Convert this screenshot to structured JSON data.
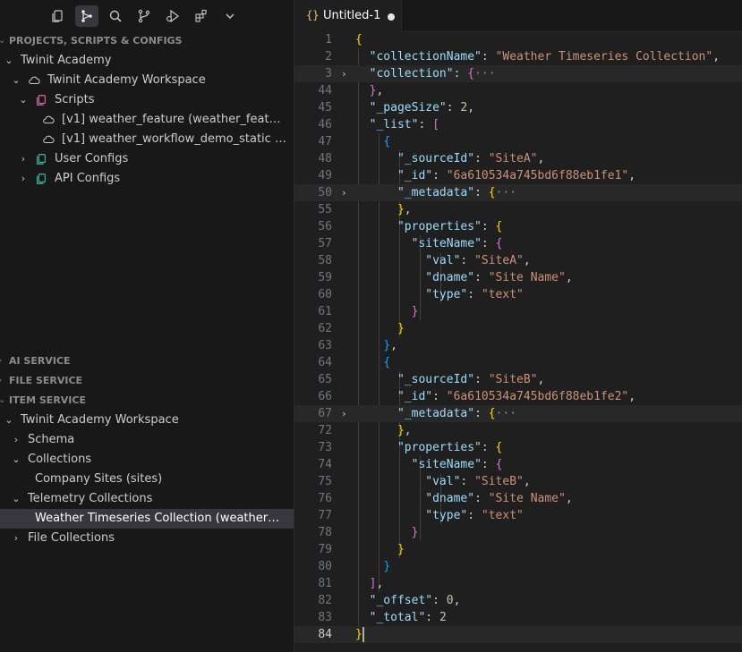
{
  "toolbar": {
    "icons": [
      "files-icon",
      "workflow-icon",
      "search-icon",
      "source-control-icon",
      "run-debug-icon",
      "extensions-icon",
      "chevron-down-icon"
    ]
  },
  "sidebar": {
    "section_projects": "PROJECTS, SCRIPTS & CONFIGS",
    "projects_tree": [
      "Twinit Academy",
      "Twinit Academy Workspace",
      "Scripts",
      "[v1] weather_feature (weather_feature) <...",
      "[v1] weather_workflow_demo_static (weat...",
      "User Configs",
      "API Configs"
    ],
    "section_ai": "AI SERVICE",
    "section_file": "FILE SERVICE",
    "section_item": "ITEM SERVICE",
    "item_tree": [
      "Twinit Academy Workspace",
      "Schema",
      "Collections",
      "Company Sites (sites)",
      "Telemetry Collections",
      "Weather Timeseries Collection (weather_times...",
      "File Collections"
    ]
  },
  "editor": {
    "tab_icon": "{}",
    "tab_title": "Untitled-1",
    "line_numbers": [
      "1",
      "2",
      "3",
      "44",
      "45",
      "46",
      "47",
      "48",
      "49",
      "50",
      "55",
      "56",
      "57",
      "58",
      "59",
      "60",
      "61",
      "62",
      "63",
      "64",
      "65",
      "66",
      "67",
      "72",
      "73",
      "74",
      "75",
      "76",
      "77",
      "78",
      "79",
      "80",
      "81",
      "82",
      "83",
      "84"
    ],
    "current_line": "84",
    "strings": {
      "collectionName_key": "\"collectionName\"",
      "collectionName_val": "\"Weather Timeseries Collection\"",
      "collection_key": "\"collection\"",
      "pageSize_key": "\"_pageSize\"",
      "pageSize_val": "2",
      "list_key": "\"_list\"",
      "sourceId_key": "\"_sourceId\"",
      "siteA": "\"SiteA\"",
      "siteB": "\"SiteB\"",
      "id_key": "\"_id\"",
      "idA": "\"6a610534a745bd6f88eb1fe1\"",
      "idB": "\"6a610534a745bd6f88eb1fe2\"",
      "metadata_key": "\"_metadata\"",
      "properties_key": "\"properties\"",
      "siteName_key": "\"siteName\"",
      "val_key": "\"val\"",
      "dname_key": "\"dname\"",
      "dname_val": "\"Site Name\"",
      "type_key": "\"type\"",
      "type_val": "\"text\"",
      "offset_key": "\"_offset\"",
      "offset_val": "0",
      "total_key": "\"_total\"",
      "total_val": "2",
      "ellipsis": "···"
    }
  }
}
